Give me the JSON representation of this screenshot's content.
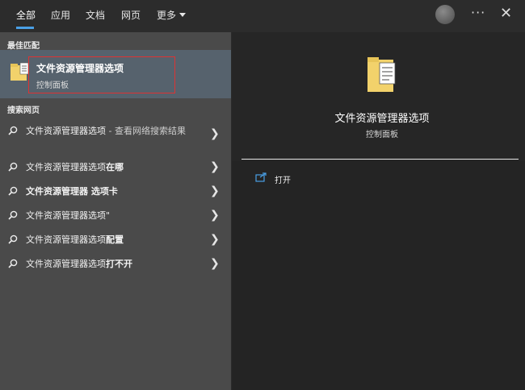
{
  "tabs": [
    {
      "label": "全部"
    },
    {
      "label": "应用"
    },
    {
      "label": "文档"
    },
    {
      "label": "网页"
    },
    {
      "label": "更多"
    }
  ],
  "window_controls": {
    "menu": "···",
    "close": "✕"
  },
  "left": {
    "best_match_header": "最佳匹配",
    "best_match": {
      "title": "文件资源管理器选项",
      "subtitle": "控制面板"
    },
    "web_header": "搜索网页",
    "web_results": [
      {
        "prefix": "文件资源管理器选项",
        "bold": "",
        "suffix": " - 查看网络搜索结果"
      },
      {
        "prefix": "文件资源管理器选项",
        "bold": "在哪",
        "suffix": ""
      },
      {
        "prefix": "",
        "bold": "文件资源管理器 选项卡",
        "suffix": ""
      },
      {
        "prefix": "文件资源管理器选项\"",
        "bold": "",
        "suffix": ""
      },
      {
        "prefix": "文件资源管理器选项",
        "bold": "配置",
        "suffix": ""
      },
      {
        "prefix": "文件资源管理器选项",
        "bold": "打不开",
        "suffix": ""
      }
    ]
  },
  "right": {
    "title": "文件资源管理器选项",
    "subtitle": "控制面板",
    "actions": [
      {
        "label": "打开"
      }
    ]
  },
  "colors": {
    "accent": "#4aa0e6",
    "highlight_box": "#dd3333",
    "folder": "#f2d26b"
  }
}
